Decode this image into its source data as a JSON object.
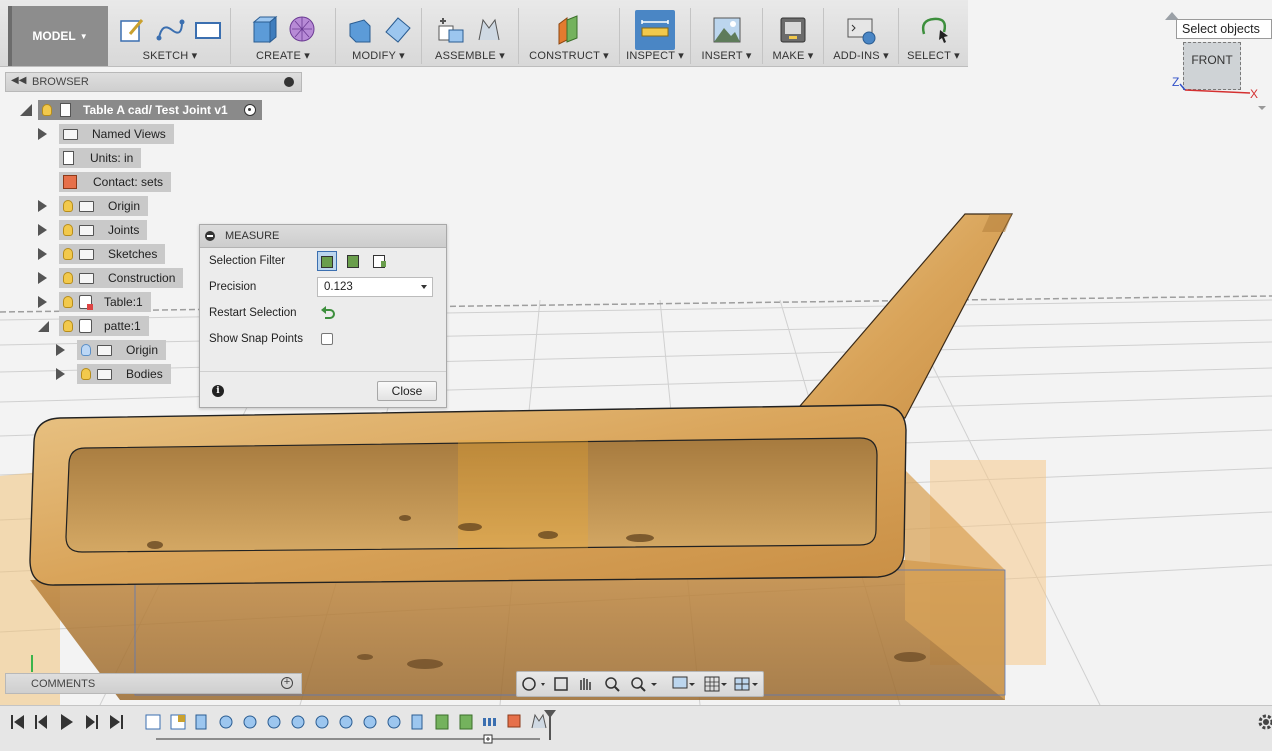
{
  "toolbar": {
    "workspace": "MODEL",
    "groups": [
      {
        "label": "SKETCH"
      },
      {
        "label": "CREATE"
      },
      {
        "label": "MODIFY"
      },
      {
        "label": "ASSEMBLE"
      },
      {
        "label": "CONSTRUCT"
      },
      {
        "label": "INSPECT"
      },
      {
        "label": "INSERT"
      },
      {
        "label": "MAKE"
      },
      {
        "label": "ADD-INS"
      },
      {
        "label": "SELECT"
      }
    ]
  },
  "browser": {
    "title": "BROWSER",
    "root": "Table A cad/ Test Joint v1",
    "items": [
      {
        "label": "Named Views",
        "icon": "folder-icon"
      },
      {
        "label": "Units: in",
        "icon": "document-icon"
      },
      {
        "label": "Contact: sets",
        "icon": "contact-sets-icon"
      },
      {
        "label": "Origin",
        "icon": "folder-icon"
      },
      {
        "label": "Joints",
        "icon": "folder-icon"
      },
      {
        "label": "Sketches",
        "icon": "folder-icon"
      },
      {
        "label": "Construction",
        "icon": "folder-icon"
      },
      {
        "label": "Table:1",
        "icon": "component-icon"
      },
      {
        "label": "patte:1",
        "icon": "component-icon"
      },
      {
        "label": "Origin",
        "icon": "folder-icon"
      },
      {
        "label": "Bodies",
        "icon": "folder-icon"
      }
    ]
  },
  "measure": {
    "title": "MEASURE",
    "selection_filter_label": "Selection Filter",
    "precision_label": "Precision",
    "precision_value": "0.123",
    "restart_label": "Restart Selection",
    "snap_label": "Show Snap Points",
    "snap_checked": false,
    "close_label": "Close"
  },
  "comments": {
    "title": "COMMENTS"
  },
  "viewcube": {
    "face": "FRONT",
    "axis_x": "X",
    "axis_z": "Z"
  },
  "tooltip": "Select objects",
  "colors": {
    "wood": "#d9a45a",
    "inspect_active": "#4a86c5",
    "toolbar": "#dcdcdc"
  }
}
